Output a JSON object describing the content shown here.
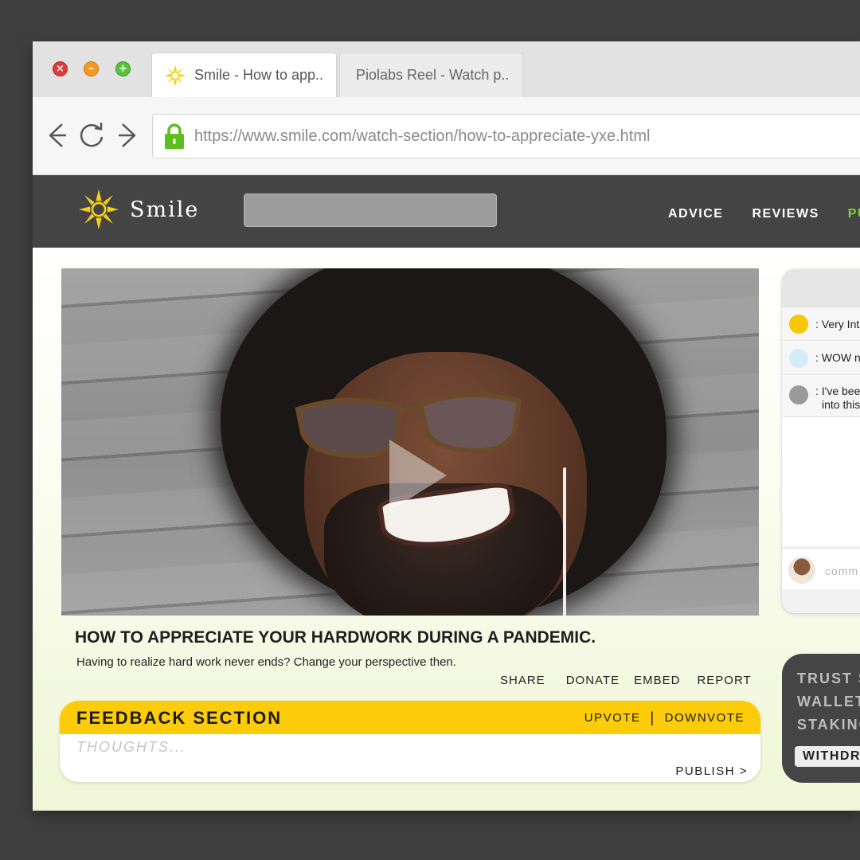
{
  "browser": {
    "tabs": [
      {
        "title": "Smile - How to app..",
        "active": true
      },
      {
        "title": "Piolabs Reel - Watch p..",
        "active": false
      }
    ],
    "url": "https://www.smile.com/watch-section/how-to-appreciate-yxe.html",
    "secure": true,
    "colors": {
      "close": "#e03a3a",
      "minimize": "#f59a1c",
      "maximize": "#58c23a",
      "lock": "#5cbf1f"
    }
  },
  "site": {
    "brand": "Smile",
    "nav": [
      "ADVICE",
      "REVIEWS",
      "PU"
    ],
    "nav_highlight_color": "#7ed23a",
    "header_color": "#444444"
  },
  "video": {
    "title": "HOW TO APPRECIATE YOUR HARDWORK DURING A PANDEMIC.",
    "description": "Having to realize hard work never ends? Change your perspective then.",
    "actions": [
      "SHARE",
      "DONATE",
      "EMBED",
      "REPORT"
    ]
  },
  "feedback": {
    "title": "FEEDBACK SECTION",
    "upvote": "UPVOTE",
    "separator": "|",
    "downvote": "DOWNVOTE",
    "placeholder": "THOUGHTS...",
    "publish": "PUBLISH >",
    "accent": "#fccc0a"
  },
  "chat": {
    "comments": [
      {
        "line1": ": Very Int",
        "line2": "",
        "avatar_color": "#f5c800"
      },
      {
        "line1": ": WOW n",
        "line2": "",
        "avatar_color": "#d6ecf7"
      },
      {
        "line1": ": I've bee",
        "line2": "into this",
        "avatar_color": "#9a9a9a"
      }
    ],
    "comment_placeholder": "comm"
  },
  "wallet": {
    "items": [
      "TRUST S",
      "WALLET",
      "STAKING"
    ],
    "button": "WITHDR"
  }
}
